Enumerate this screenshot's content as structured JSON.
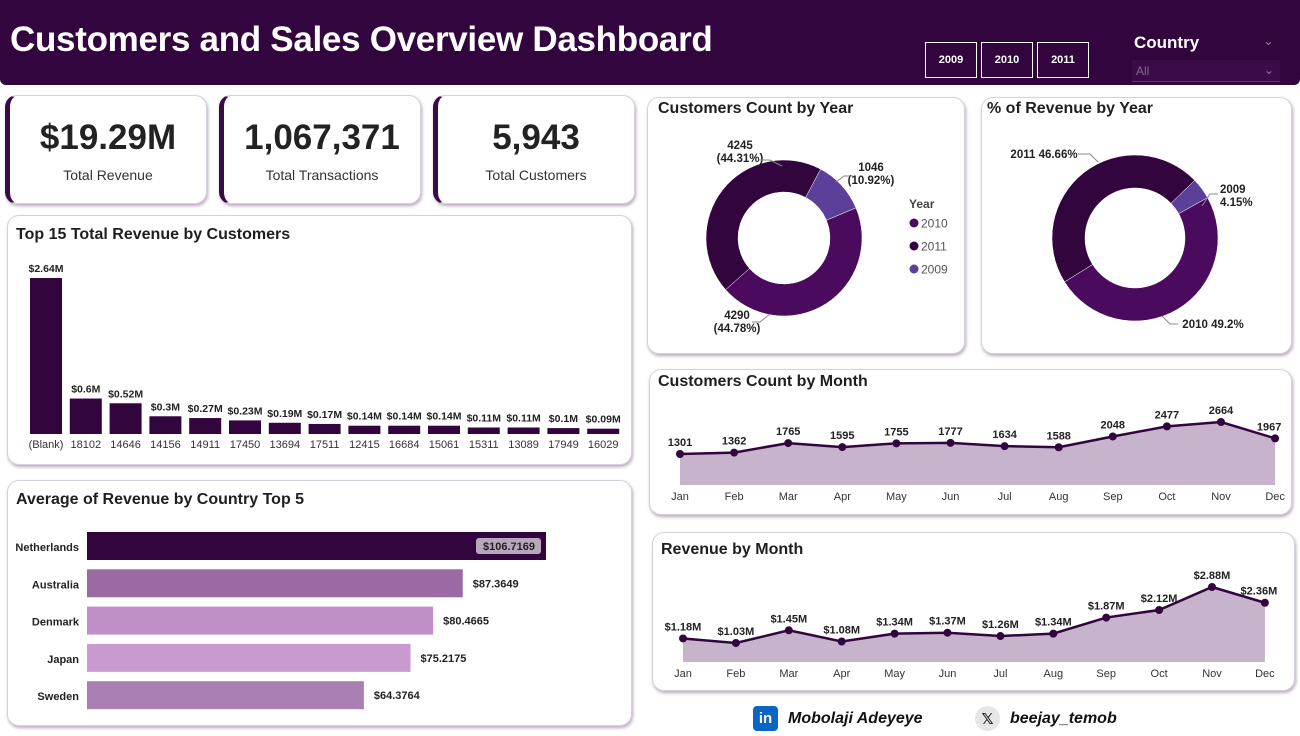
{
  "header": {
    "title": "Customers and Sales Overview Dashboard",
    "year_buttons": [
      "2009",
      "2010",
      "2011"
    ],
    "country_slicer": {
      "title": "Country",
      "value": "All"
    }
  },
  "kpis": [
    {
      "value": "$19.29M",
      "label": "Total Revenue"
    },
    {
      "value": "1,067,371",
      "label": "Total Transactions"
    },
    {
      "value": "5,943",
      "label": "Total Customers"
    }
  ],
  "colors": {
    "dark_purple": "#33053f",
    "mid_purple": "#4a0a5e",
    "light_purple": "#5b3f98",
    "bar_mid": "#9b6aa5",
    "bar_light": "#c08fc8",
    "area_fill": "#c7b3cc"
  },
  "chart_data": [
    {
      "id": "top15",
      "type": "bar",
      "title": "Top 15 Total Revenue by Customers",
      "categories": [
        "(Blank)",
        "18102",
        "14646",
        "14156",
        "14911",
        "17450",
        "13694",
        "17511",
        "12415",
        "16684",
        "15061",
        "15311",
        "13089",
        "17949",
        "16029"
      ],
      "values": [
        2.64,
        0.6,
        0.52,
        0.3,
        0.27,
        0.23,
        0.19,
        0.17,
        0.14,
        0.14,
        0.14,
        0.11,
        0.11,
        0.1,
        0.09
      ],
      "data_labels": [
        "$2.64M",
        "$0.6M",
        "$0.52M",
        "$0.3M",
        "$0.27M",
        "$0.23M",
        "$0.19M",
        "$0.17M",
        "$0.14M",
        "$0.14M",
        "$0.14M",
        "$0.11M",
        "$0.11M",
        "$0.1M",
        "$0.09M"
      ],
      "color": "#33053f"
    },
    {
      "id": "country",
      "type": "bar",
      "orientation": "horizontal",
      "title": "Average of Revenue by Country Top 5",
      "categories": [
        "Netherlands",
        "Australia",
        "Denmark",
        "Japan",
        "Sweden"
      ],
      "values": [
        106.7169,
        87.3649,
        80.4665,
        75.2175,
        64.3764
      ],
      "data_labels": [
        "$106.7169",
        "$87.3649",
        "$80.4665",
        "$75.2175",
        "$64.3764"
      ],
      "colors": [
        "#33053f",
        "#9b6aa5",
        "#c08fc8",
        "#c99ad0",
        "#a97eb2"
      ]
    },
    {
      "id": "cust_year",
      "type": "pie",
      "title": "Customers Count by Year",
      "slices": [
        {
          "name": "2010",
          "value": 4290,
          "label": "4290\n(44.78%)",
          "color": "#4a0a5e"
        },
        {
          "name": "2011",
          "value": 4245,
          "label": "4245\n(44.31%)",
          "color": "#33053f"
        },
        {
          "name": "2009",
          "value": 1046,
          "label": "1046\n(10.92%)",
          "color": "#5b3f98"
        }
      ],
      "legend_title": "Year",
      "legend": [
        "2010",
        "2011",
        "2009"
      ],
      "legend_placement": "right"
    },
    {
      "id": "rev_year",
      "type": "pie",
      "title": "% of Revenue by Year",
      "slices": [
        {
          "name": "2010",
          "value": 49.2,
          "label": "2010 49.2%",
          "color": "#4a0a5e"
        },
        {
          "name": "2011",
          "value": 46.66,
          "label": "2011 46.66%",
          "color": "#33053f"
        },
        {
          "name": "2009",
          "value": 4.15,
          "label": "2009\n4.15%",
          "color": "#5b3f98"
        }
      ]
    },
    {
      "id": "cust_month",
      "type": "area",
      "title": "Customers Count by Month",
      "categories": [
        "Jan",
        "Feb",
        "Mar",
        "Apr",
        "May",
        "Jun",
        "Jul",
        "Aug",
        "Sep",
        "Oct",
        "Nov",
        "Dec"
      ],
      "values": [
        1301,
        1362,
        1765,
        1595,
        1755,
        1777,
        1634,
        1588,
        2048,
        2477,
        2664,
        1967
      ],
      "data_labels": [
        "1301",
        "1362",
        "1765",
        "1595",
        "1755",
        "1777",
        "1634",
        "1588",
        "2048",
        "2477",
        "2664",
        "1967"
      ]
    },
    {
      "id": "rev_month",
      "type": "area",
      "title": "Revenue by Month",
      "categories": [
        "Jan",
        "Feb",
        "Mar",
        "Apr",
        "May",
        "Jun",
        "Jul",
        "Aug",
        "Sep",
        "Oct",
        "Nov",
        "Dec"
      ],
      "values": [
        1.18,
        1.03,
        1.45,
        1.08,
        1.34,
        1.37,
        1.26,
        1.34,
        1.87,
        2.12,
        2.88,
        2.36
      ],
      "data_labels": [
        "$1.18M",
        "$1.03M",
        "$1.45M",
        "$1.08M",
        "$1.34M",
        "$1.37M",
        "$1.26M",
        "$1.34M",
        "$1.87M",
        "$2.12M",
        "$2.88M",
        "$2.36M"
      ]
    }
  ],
  "footer": {
    "linkedin_icon": "linkedin-icon",
    "linkedin_name": "Mobolaji Adeyeye",
    "x_icon": "x-icon",
    "x_handle": "beejay_temob"
  }
}
